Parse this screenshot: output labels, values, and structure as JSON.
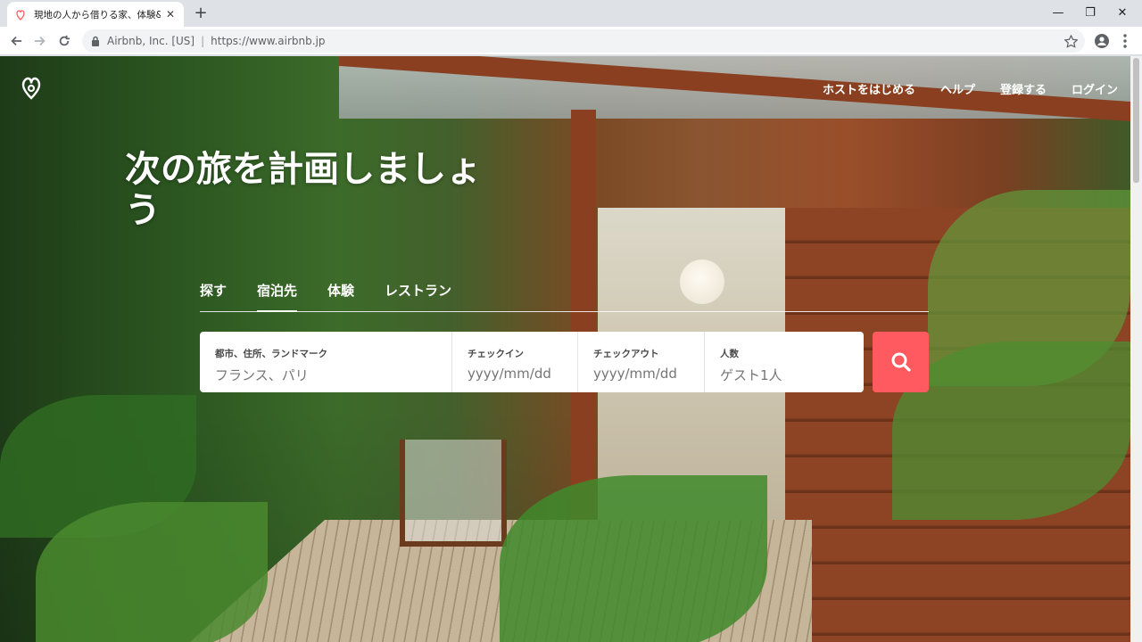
{
  "browser": {
    "tab_title": "現地の人から借りる家、体験&スポッ",
    "new_tab": "+",
    "close_tab": "✕",
    "window_minimize": "—",
    "window_maximize": "❐",
    "window_close": "✕",
    "site_org": "Airbnb, Inc. [US]",
    "url": "https://www.airbnb.jp",
    "separator": "|"
  },
  "header": {
    "nav": [
      "ホストをはじめる",
      "ヘルプ",
      "登録する",
      "ログイン"
    ]
  },
  "hero": {
    "headline": "次の旅を計画しましょう"
  },
  "tabs": [
    {
      "label": "探す",
      "active": false
    },
    {
      "label": "宿泊先",
      "active": true
    },
    {
      "label": "体験",
      "active": false
    },
    {
      "label": "レストラン",
      "active": false
    }
  ],
  "search": {
    "location_label": "都市、住所、ランドマーク",
    "location_placeholder": "フランス、パリ",
    "checkin_label": "チェックイン",
    "checkin_placeholder": "yyyy/mm/dd",
    "checkout_label": "チェックアウト",
    "checkout_placeholder": "yyyy/mm/dd",
    "guests_label": "人数",
    "guests_value": "ゲスト1人"
  },
  "colors": {
    "brand": "#ff5a5f",
    "white": "#ffffff"
  },
  "icons": {
    "favicon": "airbnb-logo-icon",
    "search": "search-icon",
    "lock": "lock-icon",
    "star": "star-icon",
    "account": "account-icon",
    "menu": "more-vert-icon"
  }
}
